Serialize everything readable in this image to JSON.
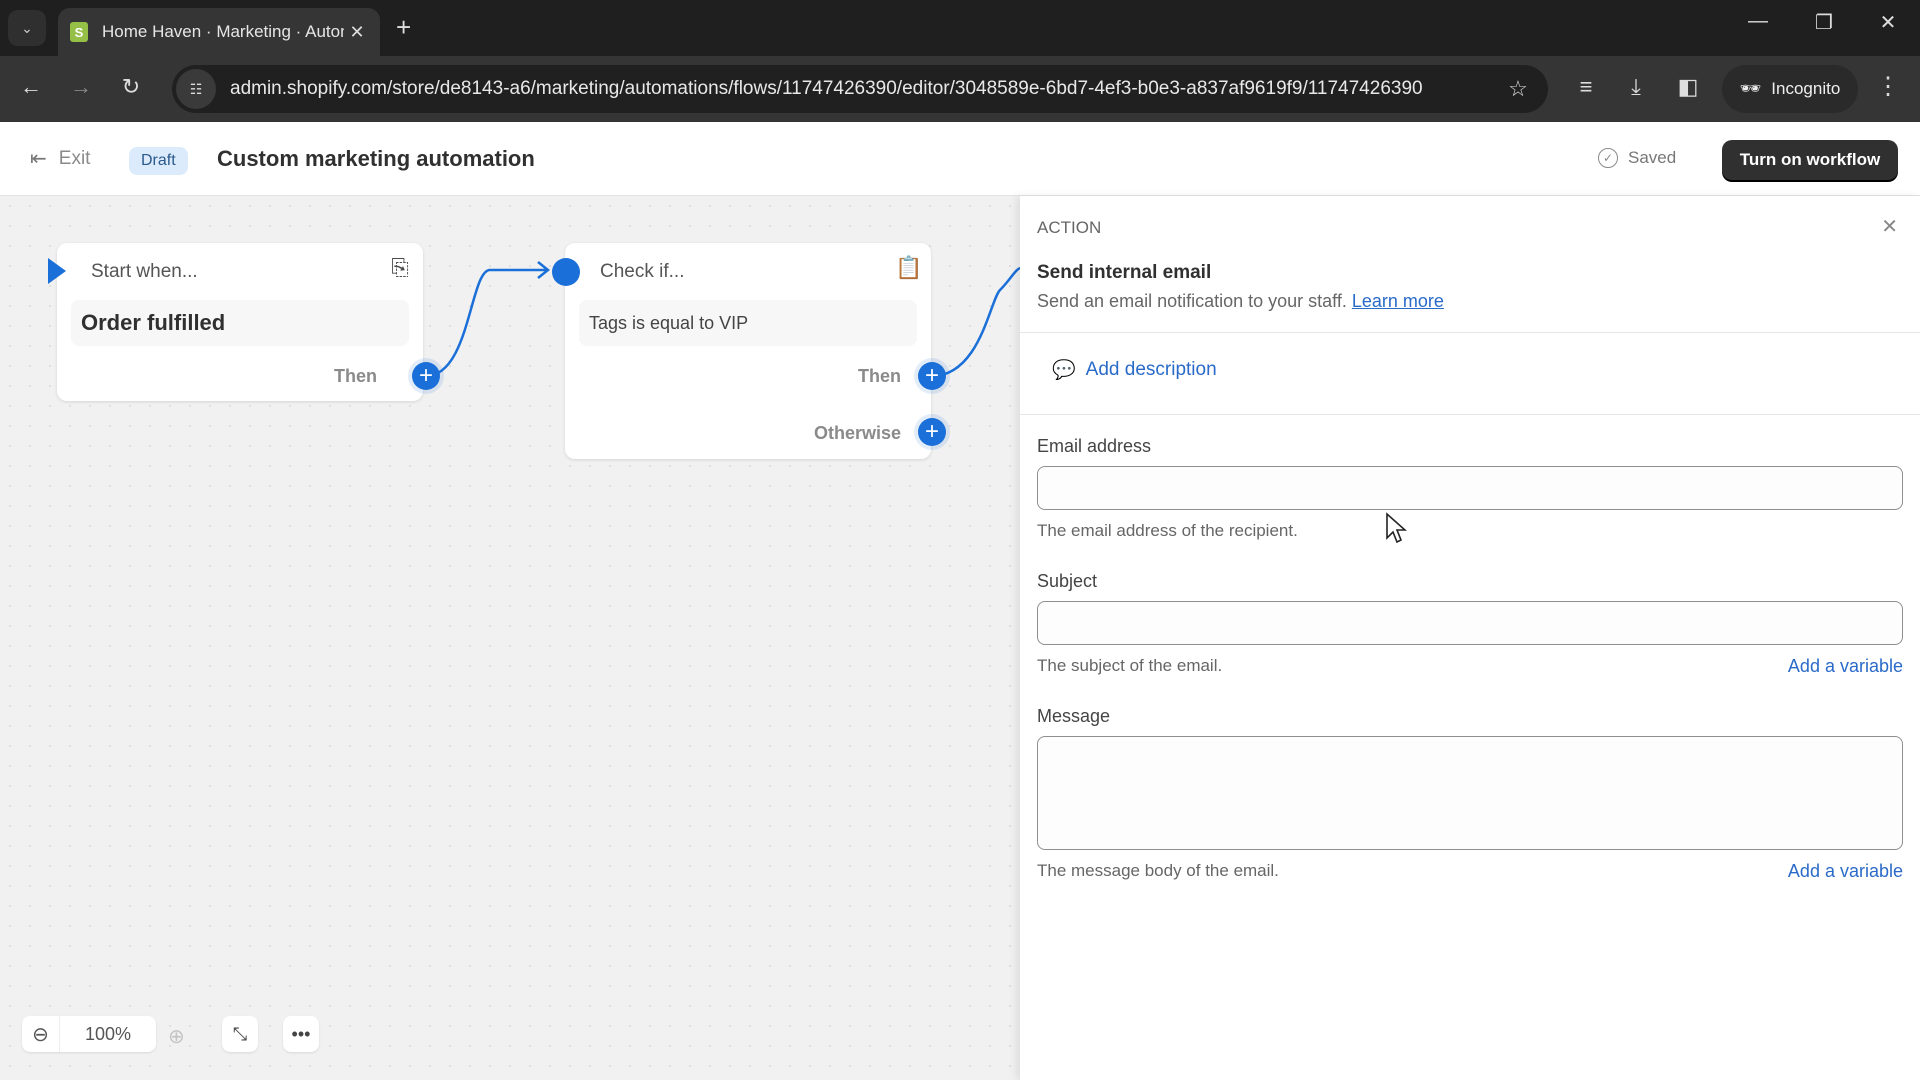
{
  "browser": {
    "tab_title": "Home Haven · Marketing · Automations",
    "url": "admin.shopify.com/store/de8143-a6/marketing/automations/flows/11747426390/editor/3048589e-6bd7-4ef3-b0e3-a837af9619f9/11747426390",
    "incognito_label": "Incognito",
    "icons": {
      "tab_list": "chevron-down-icon",
      "tab_close": "close-icon",
      "new_tab": "plus-icon",
      "back": "arrow-left-icon",
      "forward": "arrow-right-icon",
      "reload": "reload-icon",
      "site_info": "tune-icon",
      "bookmark": "star-icon",
      "media": "media-queue-icon",
      "downloads": "download-icon",
      "side_panel": "side-panel-icon",
      "incognito": "incognito-icon",
      "menu": "kebab-menu-icon"
    }
  },
  "header": {
    "exit_label": "Exit",
    "status_badge": "Draft",
    "title": "Custom marketing automation",
    "saved_label": "Saved",
    "primary_button": "Turn on workflow"
  },
  "canvas": {
    "nodes": [
      {
        "type_label": "Start when...",
        "body": "Order fulfilled",
        "icon": "inbox-download-icon",
        "branches": [
          "Then"
        ]
      },
      {
        "type_label": "Check if...",
        "body": "Tags is equal to VIP",
        "icon": "clipboard-check-icon",
        "branches": [
          "Then",
          "Otherwise"
        ]
      }
    ],
    "zoom_level": "100%"
  },
  "panel": {
    "type": "ACTION",
    "title": "Send internal email",
    "description": "Send an email notification to your staff.",
    "learn_more": "Learn more",
    "add_description": "Add description",
    "fields": [
      {
        "label": "Email address",
        "value": "",
        "help": "The email address of the recipient.",
        "add_variable": ""
      },
      {
        "label": "Subject",
        "value": "",
        "help": "The subject of the email.",
        "add_variable": "Add a variable"
      },
      {
        "label": "Message",
        "value": "",
        "help": "The message body of the email.",
        "add_variable": "Add a variable"
      }
    ]
  }
}
